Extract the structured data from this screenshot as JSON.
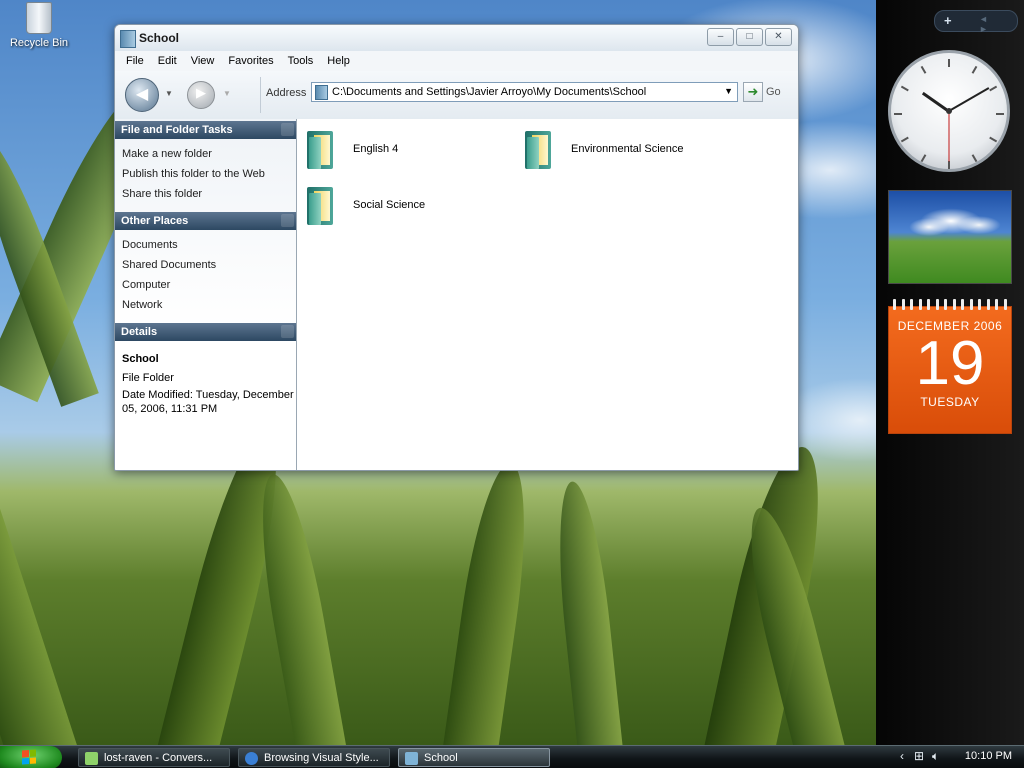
{
  "desktop": {
    "recycle_bin_label": "Recycle Bin"
  },
  "window": {
    "title": "School",
    "controls": {
      "minimize": "–",
      "maximize": "□",
      "close": "✕"
    },
    "menu": [
      "File",
      "Edit",
      "View",
      "Favorites",
      "Tools",
      "Help"
    ],
    "toolbar": {
      "back_icon": "back-arrow-icon",
      "forward_icon": "forward-arrow-icon"
    },
    "address": {
      "label": "Address",
      "value": "C:\\Documents and Settings\\Javier Arroyo\\My Documents\\School",
      "go_label": "Go"
    },
    "left_pane": {
      "file_tasks": {
        "title": "File and Folder Tasks",
        "items": [
          "Make a new folder",
          "Publish this folder to the Web",
          "Share this folder"
        ]
      },
      "other_places": {
        "title": "Other Places",
        "items": [
          "Documents",
          "Shared Documents",
          "Computer",
          "Network"
        ]
      },
      "details": {
        "title": "Details",
        "name": "School",
        "type": "File Folder",
        "modified": "Date Modified: Tuesday, December 05, 2006, 11:31 PM"
      }
    },
    "folders": [
      "English 4",
      "Environmental Science",
      "Social Science"
    ]
  },
  "sidebar": {
    "add_label": "+",
    "nav_arrows": "◄ ►",
    "clock": {
      "hour": 10,
      "minute": 10
    },
    "calendar": {
      "month": "DECEMBER 2006",
      "day": "19",
      "weekday": "TUESDAY"
    }
  },
  "taskbar": {
    "tasks": [
      {
        "label": "lost-raven - Convers...",
        "icon": "messenger-icon",
        "color": "#8fd26a"
      },
      {
        "label": "Browsing Visual Style...",
        "icon": "internet-explorer-icon",
        "color": "#3a7fd4"
      },
      {
        "label": "School",
        "icon": "folder-icon",
        "color": "#7fb3d6"
      }
    ],
    "time": "10:10 PM"
  },
  "colors": {
    "section_header": "#2d4862",
    "calendar": "#e85a12",
    "start_button": "#1f8a1f"
  }
}
